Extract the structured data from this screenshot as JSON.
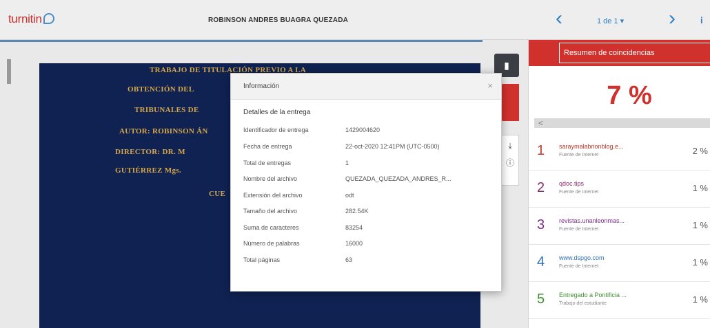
{
  "header": {
    "logo_text": "turnitin",
    "doc_title": "ROBINSON ANDRES BUAGRA QUEZADA",
    "prev_icon": "chevron-left-icon",
    "pager": "1 de 1 ▾",
    "next_icon": "chevron-right-icon",
    "more": "i"
  },
  "document": {
    "lines": [
      "TRABAJO DE TITULACIÓN PREVIO A LA",
      "OBTENCIÓN DEL",
      "TRIBUNALES DE",
      "AUTOR: ROBINSON ÁN",
      "DIRECTOR:    DR.    M",
      "GUTIÉRREZ Mgs.",
      "CUE"
    ]
  },
  "tools": {
    "doc_icon": "document-icon",
    "download_icon": "download-icon",
    "info_icon": "info-icon"
  },
  "panel": {
    "header_title": "Resumen de coincidencias",
    "percent": "7 %",
    "back_icon": "<",
    "matches": [
      {
        "num": "1",
        "source": "saraymalabrionblog.e...",
        "type": "Fuente de Internet",
        "pct": "2 %",
        "color": "#c0392b"
      },
      {
        "num": "2",
        "source": "qdoc.tips",
        "type": "Fuente de Internet",
        "pct": "1 %",
        "color": "#8e2a6e"
      },
      {
        "num": "3",
        "source": "revistas.unanleonmas...",
        "type": "Fuente de Internet",
        "pct": "1 %",
        "color": "#7d2b8b"
      },
      {
        "num": "4",
        "source": "www.dspgo.com",
        "type": "Fuente de Internet",
        "pct": "1 %",
        "color": "#2f6fb3"
      },
      {
        "num": "5",
        "source": "Entregado a Pontificia ...",
        "type": "Trabajo del estudiante",
        "pct": "1 %",
        "color": "#3c8f2f"
      }
    ]
  },
  "modal": {
    "title": "Información",
    "close": "×",
    "section": "Detalles de la entrega",
    "rows": [
      {
        "label": "Identificador de entrega",
        "value": "1429004620"
      },
      {
        "label": "Fecha de entrega",
        "value": "22-oct-2020 12:41PM (UTC-0500)"
      },
      {
        "label": "Total de entregas",
        "value": "1"
      },
      {
        "label": "Nombre del archivo",
        "value": "QUEZADA_QUEZADA_ANDRES_R..."
      },
      {
        "label": "Extensión del archivo",
        "value": "odt"
      },
      {
        "label": "Tamaño del archivo",
        "value": "282.54K"
      },
      {
        "label": "Suma de caracteres",
        "value": "83254"
      },
      {
        "label": "Número de palabras",
        "value": "16000"
      },
      {
        "label": "Total páginas",
        "value": "63"
      }
    ]
  }
}
